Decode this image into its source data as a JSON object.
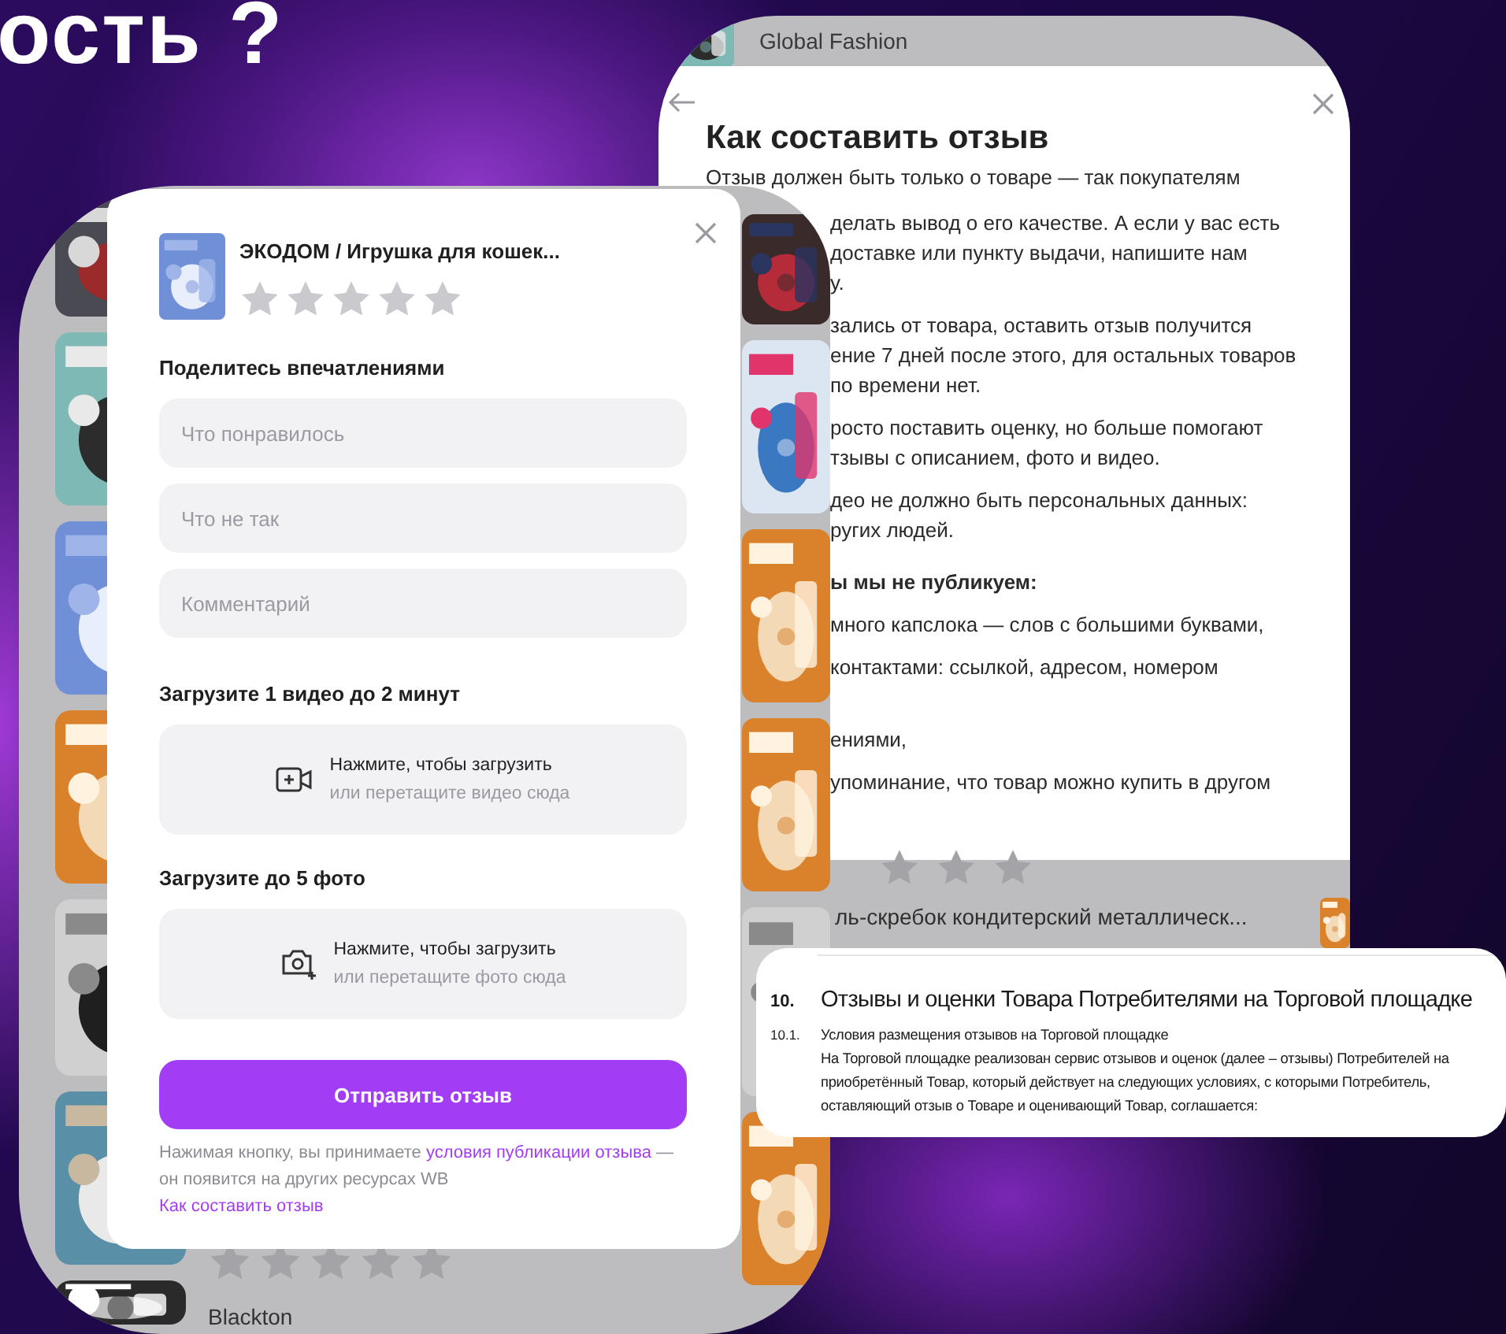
{
  "slide_title": "ость ?",
  "review_form": {
    "product_title": "ЭКОДОМ / Игрушка для кошек...",
    "stars": 0,
    "section_title": "Поделитесь впечатлениями",
    "fields": [
      {
        "placeholder": "Что понравилось"
      },
      {
        "placeholder": "Что не так"
      },
      {
        "placeholder": "Комментарий"
      }
    ],
    "uploads": [
      {
        "kind": "video",
        "title": "Загрузите 1 видео до 2 минут",
        "action": "Нажмите, чтобы загрузить",
        "hint": "или перетащите видео сюда"
      },
      {
        "title": "Загрузите до 5 фото",
        "action": "Нажмите, чтобы загрузить",
        "hint": "или перетащите фото сюда"
      }
    ],
    "submit": "Отправить отзыв",
    "disclaimer": {
      "before": "Нажимая кнопку, вы принимаете ",
      "link": "условия публикации отзыва",
      "after": " — он появится на других ресурсах WB"
    },
    "guide_link": "Как составить отзыв"
  },
  "background_listing": {
    "brand": "Blackton"
  },
  "guide": {
    "shop_name": "Global Fashion",
    "title": "Как составить отзыв",
    "intro": "Отзыв должен быть только о товаре — так покупателям",
    "paragraphs": [
      [
        "делать вывод о его качестве. А если у вас есть",
        "доставке или пункту выдачи, напишите нам",
        "у."
      ],
      [
        "зались от товара, оставить отзыв получится",
        "ение 7 дней после этого, для остальных товаров",
        "по времени нет."
      ],
      [
        "росто поставить оценку, но больше помогают",
        "тзывы с описанием, фото и видео."
      ],
      [
        "део не должно быть персональных данных:",
        "ругих людей."
      ]
    ],
    "subheading": "ы мы не публикуем:",
    "items": [
      "много капслока — слов с большими буквами,",
      "контактами: ссылкой, адресом, номером",
      "ениями,",
      "упоминание, что товар можно купить в другом"
    ],
    "listing_title": "ль-скребок кондитерский металлическ..."
  },
  "document": {
    "number": "10.",
    "heading": "Отзывы и оценки Товара Потребителями на Торговой площадке",
    "clause_number": "10.1.",
    "clause_lines": [
      "Условия размещения отзывов на Торговой площадке",
      "На Торговой площадке реализован сервис отзывов и оценок (далее – отзывы) Потребителей на",
      "приобретённый Товар, который действует на следующих условиях, с которыми Потребитель,",
      "оставляющий отзыв о Товаре и оценивающий Товар, соглашается:"
    ]
  }
}
